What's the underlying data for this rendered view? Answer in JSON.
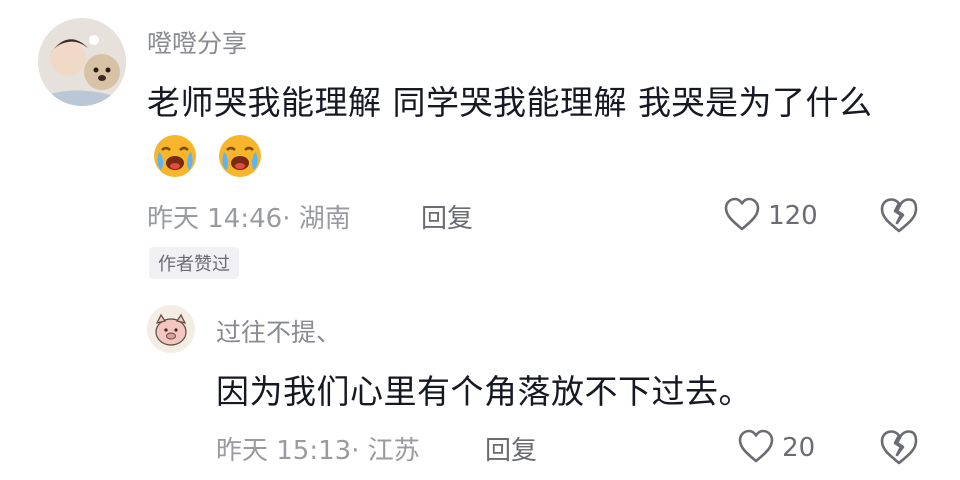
{
  "comment": {
    "author": "噔噔分享",
    "text": "老师哭我能理解 同学哭我能理解 我哭是为了什么",
    "emojis": [
      "crying-face-emoji",
      "crying-face-emoji"
    ],
    "time": "昨天 14:46",
    "location": "湖南",
    "reply_label": "回复",
    "like_count": "120",
    "author_badge": "作者赞过",
    "icons": {
      "like": "heart-outline-icon",
      "dislike": "broken-heart-icon"
    }
  },
  "reply": {
    "author": "过往不提、",
    "text": "因为我们心里有个角落放不下过去。",
    "time": "昨天 15:13",
    "location": "江苏",
    "reply_label": "回复",
    "like_count": "20",
    "icons": {
      "like": "heart-outline-icon",
      "dislike": "broken-heart-icon"
    }
  },
  "colors": {
    "text": "#161823",
    "secondary": "#8a8b91",
    "icon": "#6b6c73",
    "badge_bg": "#f1f1f3"
  }
}
